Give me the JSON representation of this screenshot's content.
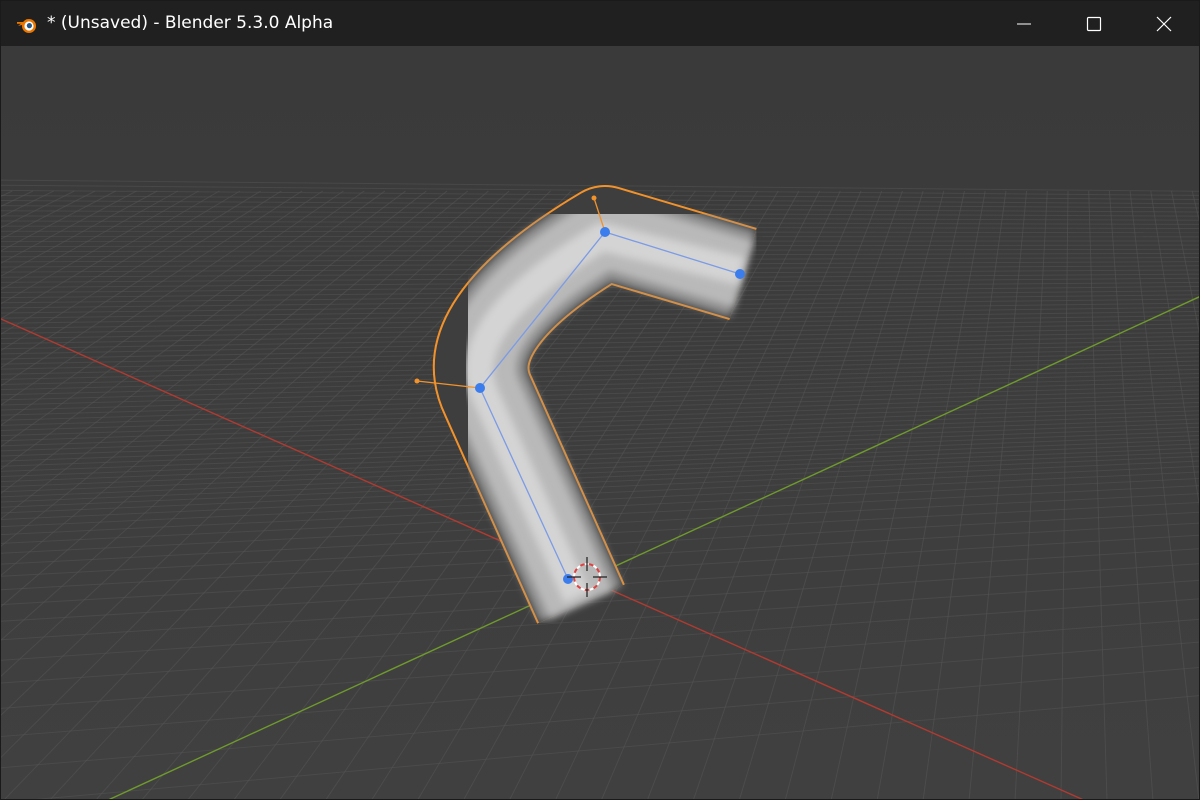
{
  "window": {
    "title": "* (Unsaved) - Blender 5.3.0 Alpha",
    "app_icon": "blender-logo-icon",
    "controls": {
      "minimize_icon": "minimize-icon",
      "maximize_icon": "maximize-icon",
      "close_icon": "close-icon"
    }
  },
  "viewport": {
    "background_top": "#3a3a3a",
    "background_bottom": "#3f3f3f",
    "grid_color": "#5a5a5a",
    "x_axis_color": "#c0392b",
    "y_axis_color": "#6a9a2a",
    "selection_outline_color": "#f2922b",
    "curve_point_color": "#3b7ded",
    "curve_line_color": "#7b9be6",
    "object_type": "bezier-curve-tube",
    "cursor_icon": "3d-cursor-icon"
  },
  "colors": {
    "titlebar_bg": "#202020",
    "titlebar_text": "#ffffff",
    "blender_orange": "#ea7600",
    "blender_blue": "#265787"
  }
}
